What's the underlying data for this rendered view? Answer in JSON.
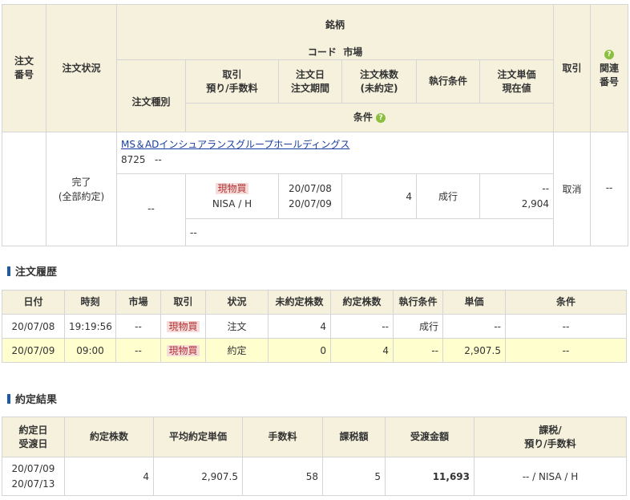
{
  "order_table": {
    "headers": {
      "order_no": "注文\n番号",
      "status": "注文状況",
      "brand": "銘柄",
      "code_market": "コード  市場",
      "order_type": "注文種別",
      "trade": "取引\n預り/手数料",
      "order_date": "注文日\n注文期間",
      "qty": "注文株数\n(未約定)",
      "exec_cond": "執行条件",
      "unit_price": "注文単価\n現在値",
      "cancel": "取引",
      "related": "関連\n番号",
      "conditions": "条件"
    },
    "row": {
      "order_no": "",
      "status": "完了\n(全部約定)",
      "stock_name": "MS＆ADインシュアランスグループホールディングス",
      "code_market": "8725   --",
      "order_type": "--",
      "trade_type": "現物買",
      "account": "NISA / H",
      "order_date": "20/07/08\n20/07/09",
      "qty": "4",
      "exec_cond": "成行",
      "unit_price": "--\n2,904",
      "cancel": "取消",
      "related": "--",
      "conditions": "--"
    }
  },
  "history": {
    "title": "注文履歴",
    "headers": [
      "日付",
      "時刻",
      "市場",
      "取引",
      "状況",
      "未約定株数",
      "約定株数",
      "執行条件",
      "単価",
      "条件"
    ],
    "rows": [
      {
        "date": "20/07/08",
        "time": "19:19:56",
        "market": "--",
        "trade": "現物買",
        "status": "注文",
        "unfilled": "4",
        "filled": "--",
        "cond": "成行",
        "price": "--",
        "extra": "--",
        "highlight": false
      },
      {
        "date": "20/07/09",
        "time": "09:00",
        "market": "--",
        "trade": "現物買",
        "status": "約定",
        "unfilled": "0",
        "filled": "4",
        "cond": "--",
        "price": "2,907.5",
        "extra": "--",
        "highlight": true
      }
    ]
  },
  "result": {
    "title": "約定結果",
    "headers": [
      "約定日\n受渡日",
      "約定株数",
      "平均約定単価",
      "手数料",
      "課税額",
      "受渡金額",
      "課税/\n預り/手数料"
    ],
    "row": {
      "dates": "20/07/09\n20/07/13",
      "qty": "4",
      "avg_price": "2,907.5",
      "fee": "58",
      "tax": "5",
      "amount": "11,693",
      "account": "-- / NISA / H"
    }
  },
  "icons": {
    "help": "help-icon",
    "section_marker": "section-bar-icon"
  },
  "colors": {
    "header_bg": "#f5f1dc",
    "highlight": "#fffecf",
    "tag_bg": "#f7dcdc",
    "tag_text": "#b03030",
    "link": "#1a3c9c",
    "help_green": "#8cbf3f",
    "section_bar": "#1e5aa8"
  }
}
